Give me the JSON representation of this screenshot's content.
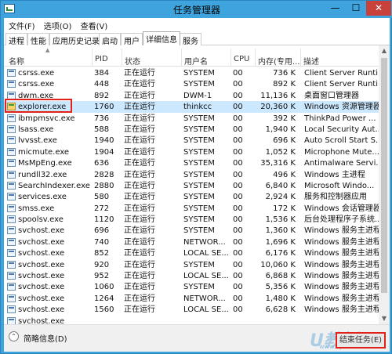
{
  "window": {
    "title": "任务管理器",
    "min": "—",
    "max": "☐",
    "close": "✕"
  },
  "menu": [
    "文件(F)",
    "选项(O)",
    "查看(V)"
  ],
  "tabs": [
    "进程",
    "性能",
    "应用历史记录",
    "启动",
    "用户",
    "详细信息",
    "服务"
  ],
  "active_tab": "详细信息",
  "columns": [
    "名称",
    "PID",
    "状态",
    "用户名",
    "CPU",
    "内存(专用...",
    "描述"
  ],
  "rows": [
    {
      "name": "csrss.exe",
      "pid": "384",
      "status": "正在运行",
      "user": "SYSTEM",
      "cpu": "00",
      "mem": "736 K",
      "desc": "Client Server Runti..."
    },
    {
      "name": "csrss.exe",
      "pid": "448",
      "status": "正在运行",
      "user": "SYSTEM",
      "cpu": "00",
      "mem": "892 K",
      "desc": "Client Server Runti..."
    },
    {
      "name": "dwm.exe",
      "pid": "892",
      "status": "正在运行",
      "user": "DWM-1",
      "cpu": "00",
      "mem": "11,136 K",
      "desc": "桌面窗口管理器"
    },
    {
      "name": "explorer.exe",
      "pid": "1760",
      "status": "正在运行",
      "user": "thinkcc",
      "cpu": "00",
      "mem": "20,360 K",
      "desc": "Windows 资源管理器"
    },
    {
      "name": "ibmpmsvc.exe",
      "pid": "736",
      "status": "正在运行",
      "user": "SYSTEM",
      "cpu": "00",
      "mem": "392 K",
      "desc": "ThinkPad Power ..."
    },
    {
      "name": "lsass.exe",
      "pid": "588",
      "status": "正在运行",
      "user": "SYSTEM",
      "cpu": "00",
      "mem": "1,940 K",
      "desc": "Local Security Aut..."
    },
    {
      "name": "lvvsst.exe",
      "pid": "1940",
      "status": "正在运行",
      "user": "SYSTEM",
      "cpu": "00",
      "mem": "696 K",
      "desc": "Auto Scroll Start S..."
    },
    {
      "name": "micmute.exe",
      "pid": "1904",
      "status": "正在运行",
      "user": "SYSTEM",
      "cpu": "00",
      "mem": "1,052 K",
      "desc": "Microphone Mute..."
    },
    {
      "name": "MsMpEng.exe",
      "pid": "636",
      "status": "正在运行",
      "user": "SYSTEM",
      "cpu": "00",
      "mem": "35,316 K",
      "desc": "Antimalware Servi..."
    },
    {
      "name": "rundll32.exe",
      "pid": "2828",
      "status": "正在运行",
      "user": "SYSTEM",
      "cpu": "00",
      "mem": "496 K",
      "desc": "Windows 主进程"
    },
    {
      "name": "SearchIndexer.exe",
      "pid": "2880",
      "status": "正在运行",
      "user": "SYSTEM",
      "cpu": "00",
      "mem": "6,840 K",
      "desc": "Microsoft Windo..."
    },
    {
      "name": "services.exe",
      "pid": "580",
      "status": "正在运行",
      "user": "SYSTEM",
      "cpu": "00",
      "mem": "2,924 K",
      "desc": "服务和控制器应用"
    },
    {
      "name": "smss.exe",
      "pid": "272",
      "status": "正在运行",
      "user": "SYSTEM",
      "cpu": "00",
      "mem": "172 K",
      "desc": "Windows 会话管理器"
    },
    {
      "name": "spoolsv.exe",
      "pid": "1120",
      "status": "正在运行",
      "user": "SYSTEM",
      "cpu": "00",
      "mem": "1,536 K",
      "desc": "后台处理程序子系统..."
    },
    {
      "name": "svchost.exe",
      "pid": "696",
      "status": "正在运行",
      "user": "SYSTEM",
      "cpu": "00",
      "mem": "1,360 K",
      "desc": "Windows 服务主进程"
    },
    {
      "name": "svchost.exe",
      "pid": "740",
      "status": "正在运行",
      "user": "NETWOR...",
      "cpu": "00",
      "mem": "1,696 K",
      "desc": "Windows 服务主进程"
    },
    {
      "name": "svchost.exe",
      "pid": "852",
      "status": "正在运行",
      "user": "LOCAL SE...",
      "cpu": "00",
      "mem": "6,176 K",
      "desc": "Windows 服务主进程"
    },
    {
      "name": "svchost.exe",
      "pid": "920",
      "status": "正在运行",
      "user": "SYSTEM",
      "cpu": "00",
      "mem": "10,060 K",
      "desc": "Windows 服务主进程"
    },
    {
      "name": "svchost.exe",
      "pid": "952",
      "status": "正在运行",
      "user": "LOCAL SE...",
      "cpu": "00",
      "mem": "6,868 K",
      "desc": "Windows 服务主进程"
    },
    {
      "name": "svchost.exe",
      "pid": "1060",
      "status": "正在运行",
      "user": "SYSTEM",
      "cpu": "00",
      "mem": "5,356 K",
      "desc": "Windows 服务主进程"
    },
    {
      "name": "svchost.exe",
      "pid": "1264",
      "status": "正在运行",
      "user": "NETWOR...",
      "cpu": "00",
      "mem": "1,480 K",
      "desc": "Windows 服务主进程"
    },
    {
      "name": "svchost.exe",
      "pid": "1560",
      "status": "正在运行",
      "user": "LOCAL SE...",
      "cpu": "00",
      "mem": "6,628 K",
      "desc": "Windows 服务主进程"
    },
    {
      "name": "svchost.exe",
      "pid": "",
      "status": "",
      "user": "",
      "cpu": "",
      "mem": "",
      "desc": ""
    }
  ],
  "footer": {
    "less_details": "简略信息(D)",
    "end_task": "结束任务(E)",
    "watermark": "U教授",
    "watermark_sub": "www.ujiaoshou.com"
  },
  "colors": {
    "titlebar": "#3fa4dd",
    "highlight": "#cce8ff",
    "callout": "#e0221b"
  }
}
